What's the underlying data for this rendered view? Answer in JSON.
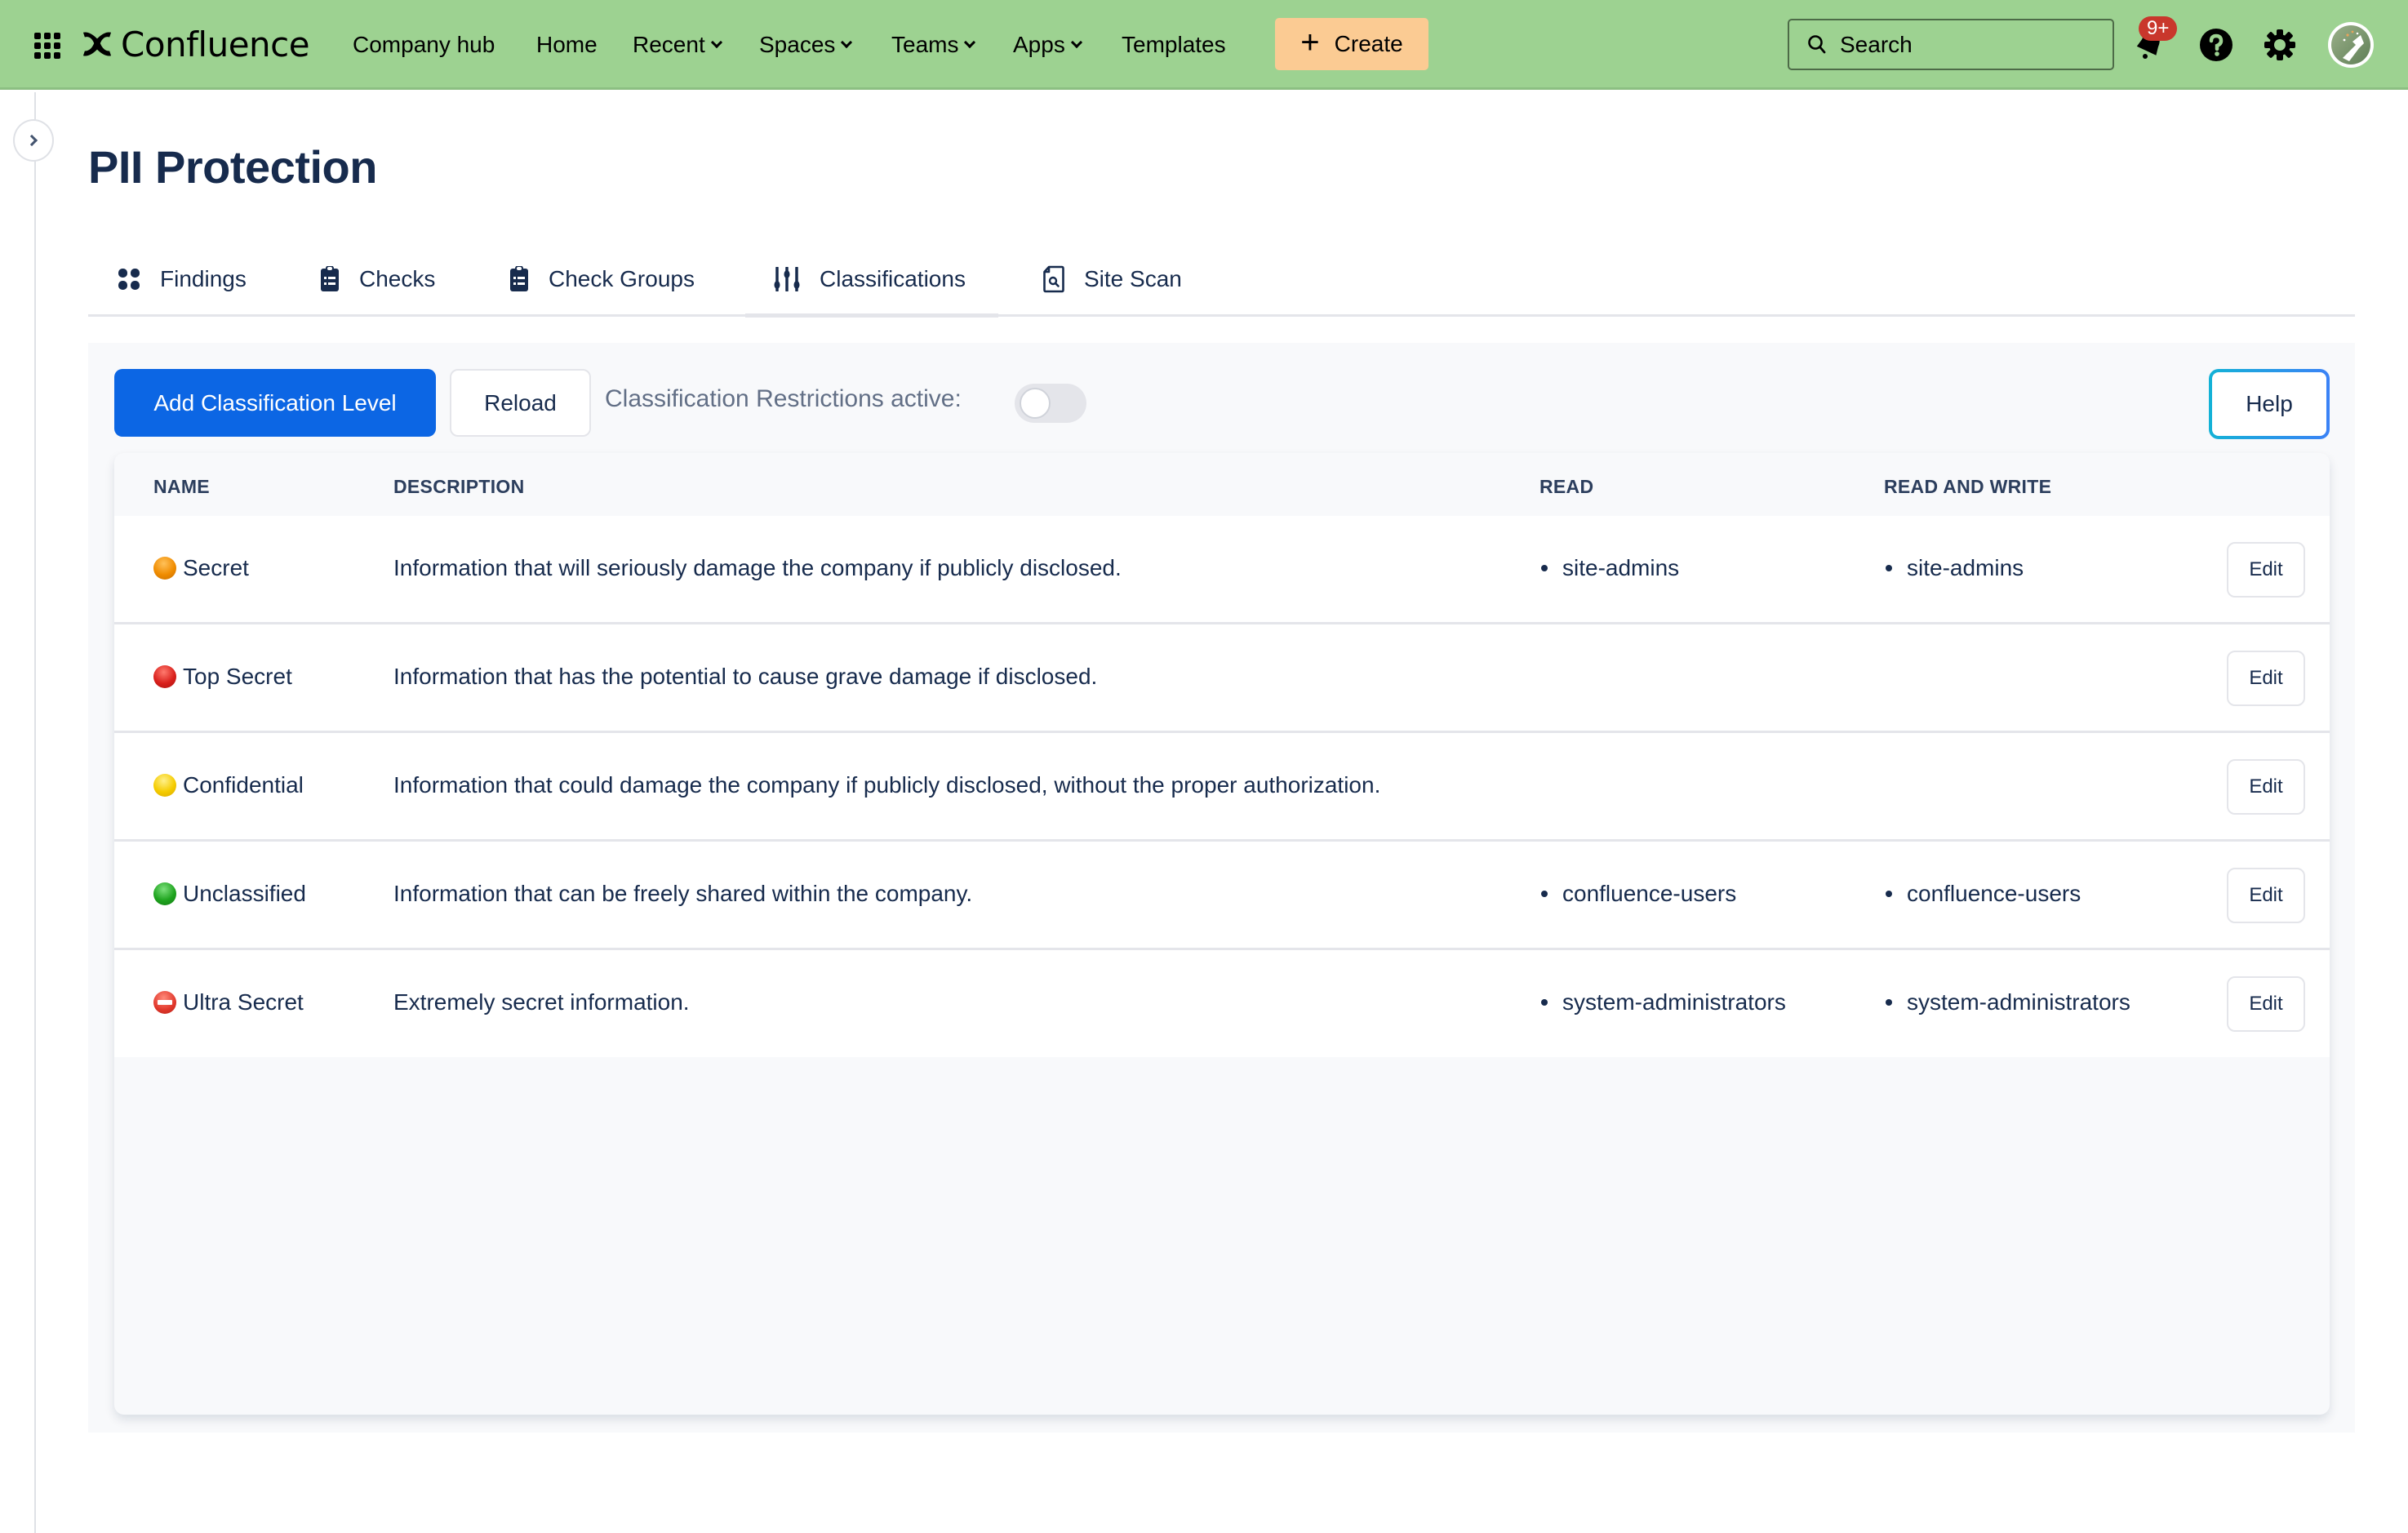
{
  "topnav": {
    "app_name": "Confluence",
    "items": [
      {
        "label": "Company hub",
        "dropdown": false
      },
      {
        "label": "Home",
        "dropdown": false
      },
      {
        "label": "Recent",
        "dropdown": true
      },
      {
        "label": "Spaces",
        "dropdown": true
      },
      {
        "label": "Teams",
        "dropdown": true
      },
      {
        "label": "Apps",
        "dropdown": true
      },
      {
        "label": "Templates",
        "dropdown": false
      }
    ],
    "create_label": "Create",
    "search_placeholder": "Search",
    "notification_badge": "9+",
    "icons": [
      "apps-grid-icon",
      "confluence-logo-icon",
      "search-icon",
      "bell-icon",
      "help-icon",
      "gear-icon",
      "avatar"
    ],
    "colors": {
      "bar": "#9dd291",
      "create": "#fbcb93",
      "badge": "#c9372c"
    }
  },
  "page": {
    "title": "PII Protection"
  },
  "tabs": [
    {
      "label": "Findings",
      "icon": "grid-icon",
      "active": false
    },
    {
      "label": "Checks",
      "icon": "clipboard-icon",
      "active": false
    },
    {
      "label": "Check Groups",
      "icon": "clipboard-icon",
      "active": false
    },
    {
      "label": "Classifications",
      "icon": "sliders-icon",
      "active": true
    },
    {
      "label": "Site Scan",
      "icon": "file-search-icon",
      "active": false
    }
  ],
  "toolbar": {
    "add_label": "Add Classification Level",
    "reload_label": "Reload",
    "restrictions_label": "Classification Restrictions active:",
    "restrictions_active": false,
    "help_label": "Help",
    "colors": {
      "primary": "#0c66e4"
    }
  },
  "table": {
    "columns": [
      "NAME",
      "DESCRIPTION",
      "READ",
      "READ AND WRITE"
    ],
    "edit_label": "Edit",
    "rows": [
      {
        "name": "Secret",
        "color": "#f08c00",
        "icon": "orange-circle-icon",
        "description": "Information that will seriously damage the company if publicly disclosed.",
        "read": [
          "site-admins"
        ],
        "read_write": [
          "site-admins"
        ]
      },
      {
        "name": "Top Secret",
        "color": "#d9201c",
        "icon": "red-circle-icon",
        "description": "Information that has the potential to cause grave damage if disclosed.",
        "read": [],
        "read_write": []
      },
      {
        "name": "Confidential",
        "color": "#f5cc00",
        "icon": "yellow-circle-icon",
        "description": "Information that could damage the company if publicly disclosed, without the proper authorization.",
        "read": [],
        "read_write": []
      },
      {
        "name": "Unclassified",
        "color": "#1fa41f",
        "icon": "green-circle-icon",
        "description": "Information that can be freely shared within the company.",
        "read": [
          "confluence-users"
        ],
        "read_write": [
          "confluence-users"
        ]
      },
      {
        "name": "Ultra Secret",
        "color": "#e0362a",
        "icon": "no-entry-icon",
        "description": "Extremely secret information.",
        "read": [
          "system-administrators"
        ],
        "read_write": [
          "system-administrators"
        ]
      }
    ]
  }
}
